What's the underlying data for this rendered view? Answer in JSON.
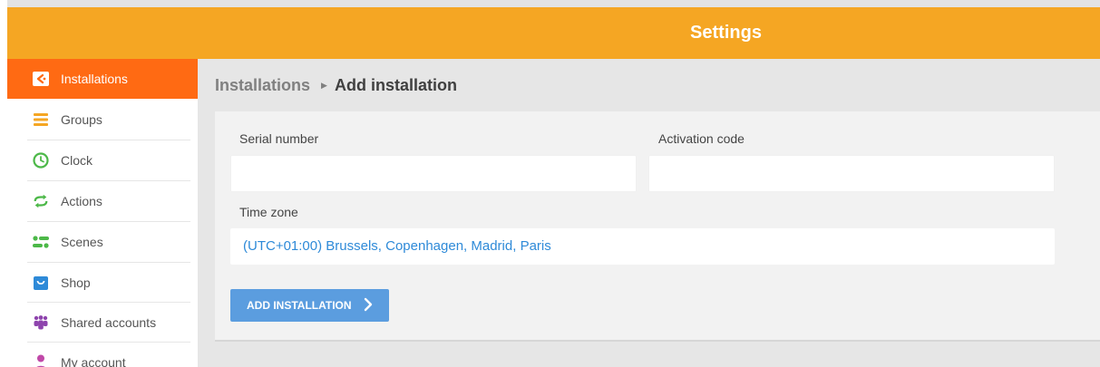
{
  "header": {
    "title": "Settings"
  },
  "colors": {
    "header": "#f5a623",
    "active": "#ff6a13",
    "button": "#5b9ddf",
    "link": "#2e8ad8"
  },
  "sidebar": {
    "items": [
      {
        "label": "Installations",
        "icon": "installations-icon",
        "active": true
      },
      {
        "label": "Groups",
        "icon": "groups-icon"
      },
      {
        "label": "Clock",
        "icon": "clock-icon"
      },
      {
        "label": "Actions",
        "icon": "actions-icon"
      },
      {
        "label": "Scenes",
        "icon": "scenes-icon"
      },
      {
        "label": "Shop",
        "icon": "shop-icon"
      },
      {
        "label": "Shared accounts",
        "icon": "shared-accounts-icon"
      },
      {
        "label": "My account",
        "icon": "my-account-icon"
      }
    ]
  },
  "breadcrumb": {
    "parent": "Installations",
    "current": "Add installation"
  },
  "form": {
    "serial_label": "Serial number",
    "serial_value": "",
    "activation_label": "Activation code",
    "activation_value": "",
    "timezone_label": "Time zone",
    "timezone_value": "(UTC+01:00) Brussels, Copenhagen, Madrid, Paris",
    "submit_label": "ADD INSTALLATION"
  }
}
